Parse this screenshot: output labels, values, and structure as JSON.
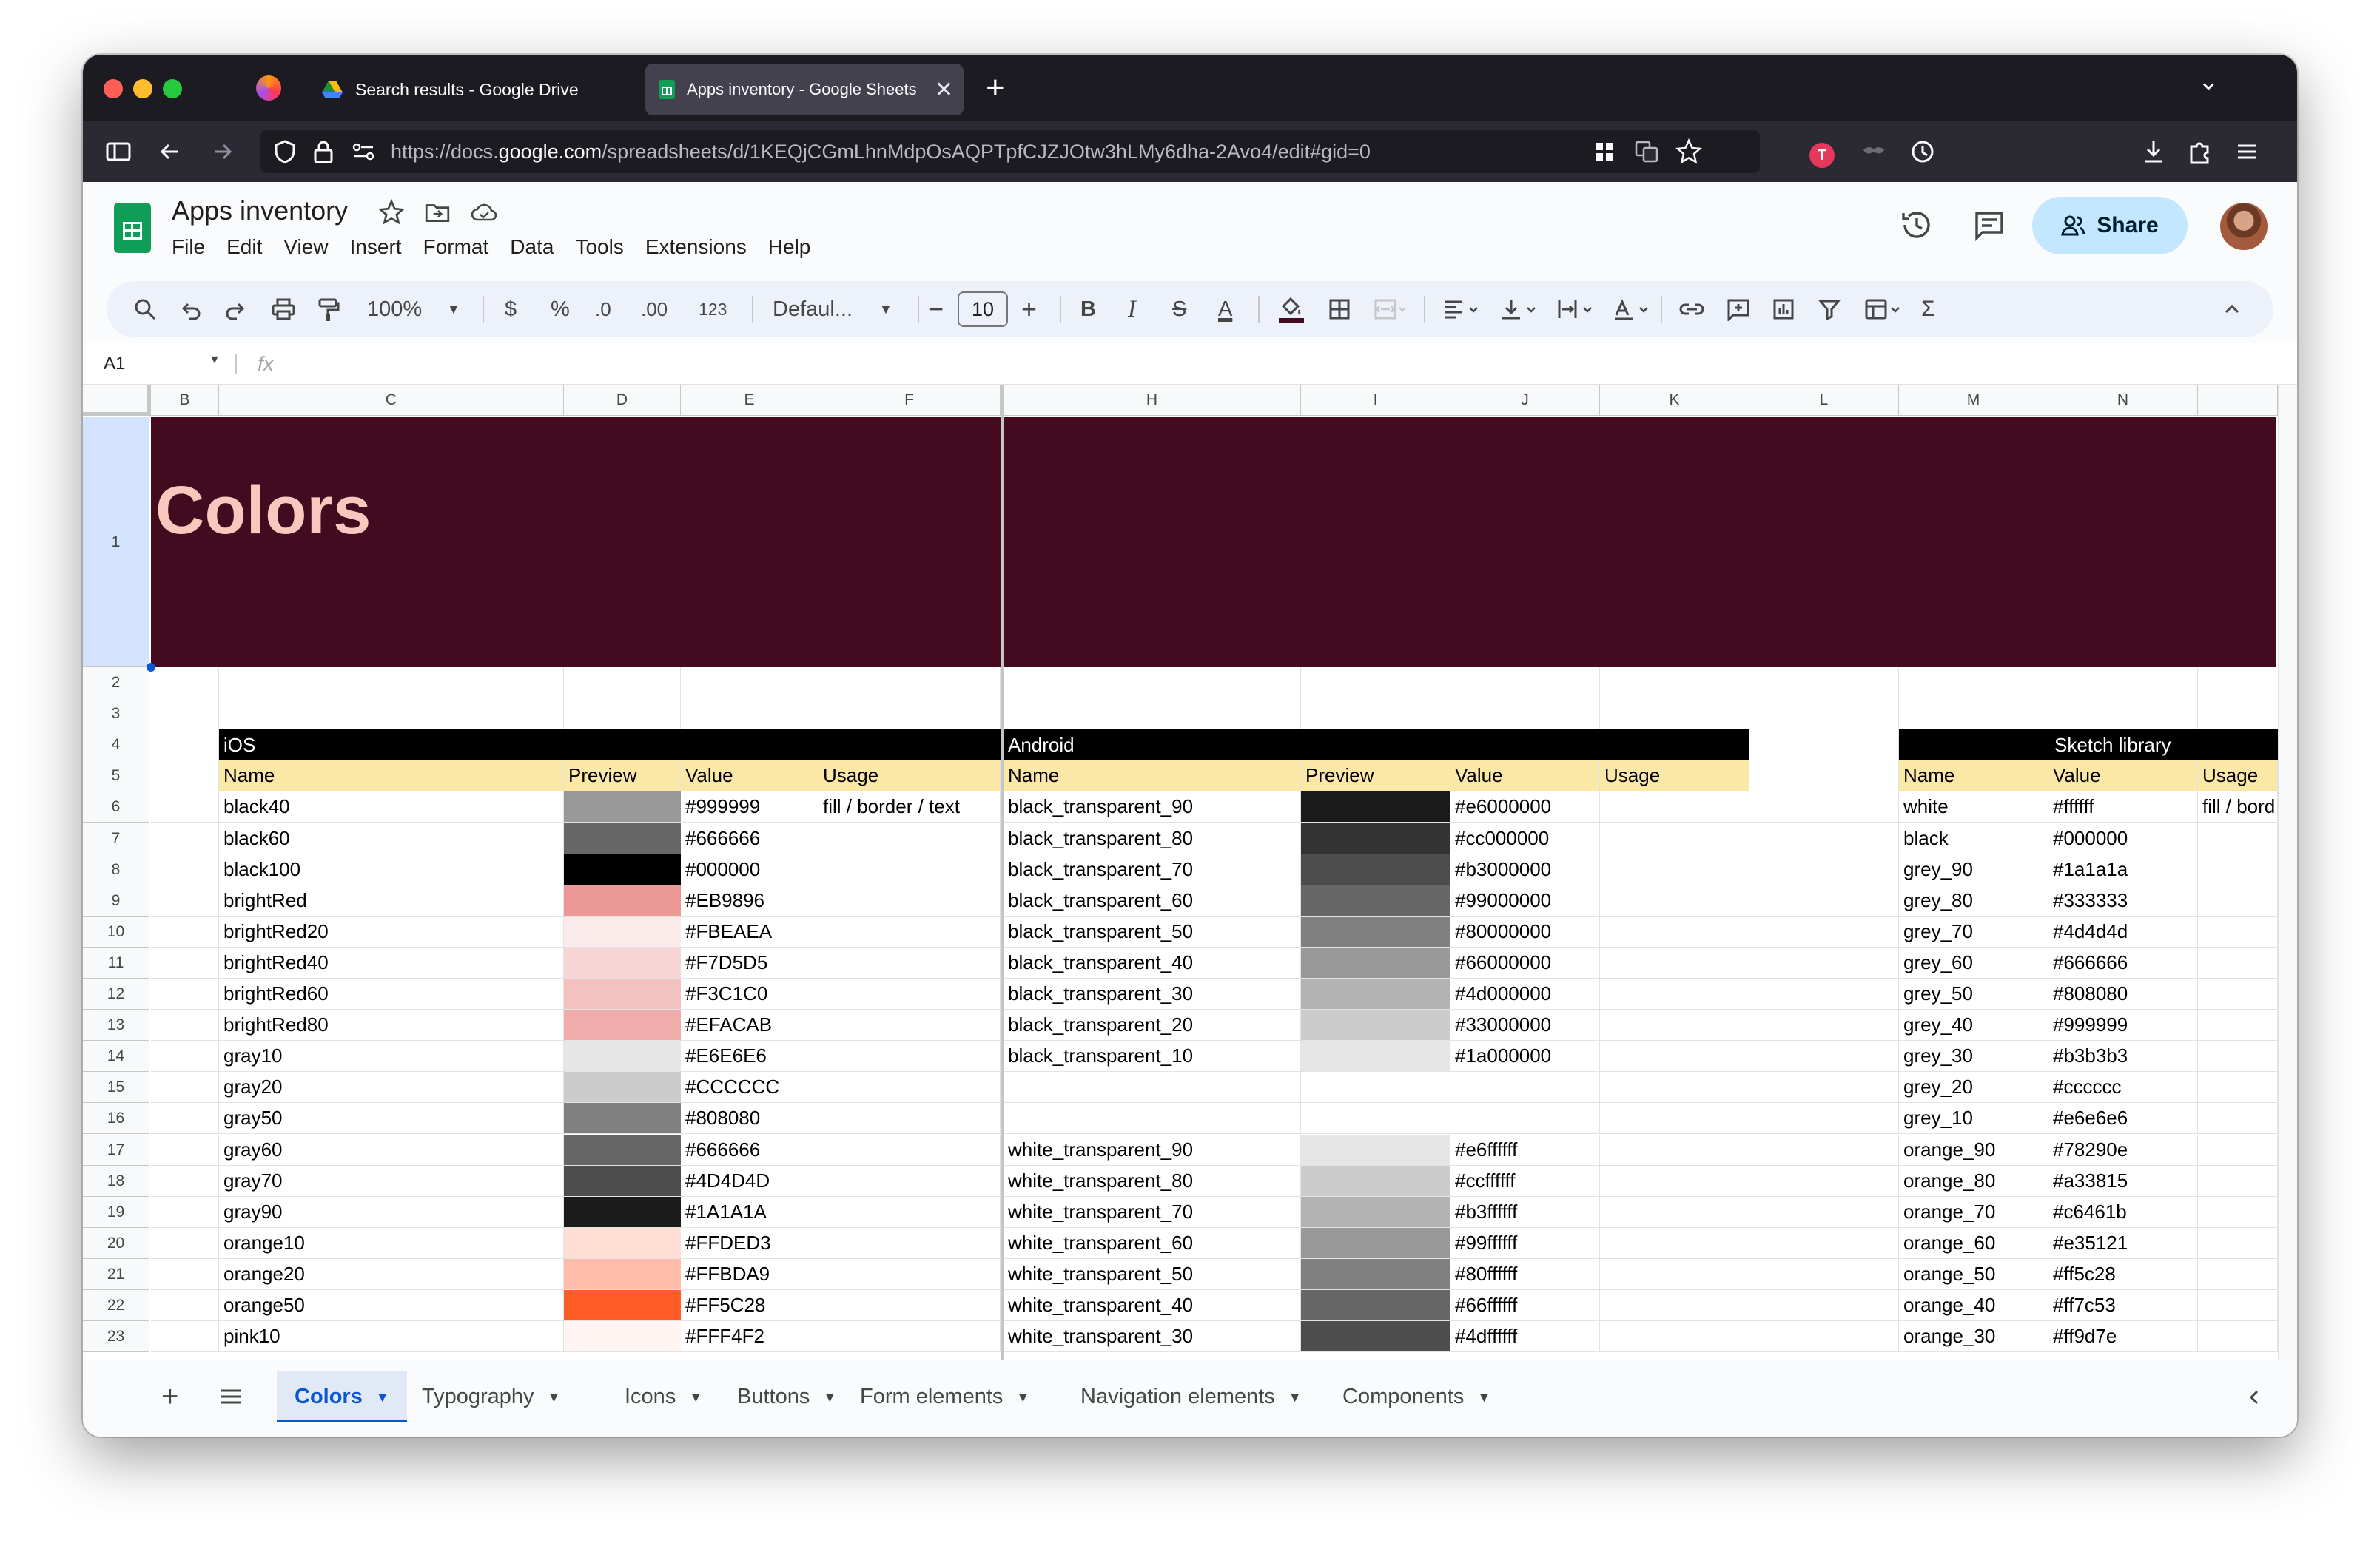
{
  "browser": {
    "tabs": [
      {
        "title": "Search results - Google Drive",
        "close": "✕"
      },
      {
        "title": "Apps inventory - Google Sheets",
        "close": "✕"
      }
    ],
    "new_tab": "+",
    "tab_list": "⌄",
    "url_prefix": "https://docs.",
    "url_domain": "google.com",
    "url_rest": "/spreadsheets/d/1KEQjCGmLhnMdpOsAQPTpfCJZJOtw3hLMy6dha-2Avo4/edit#gid=0",
    "extension_badge": "T"
  },
  "doc": {
    "title": "Apps inventory",
    "menu": [
      "File",
      "Edit",
      "View",
      "Insert",
      "Format",
      "Data",
      "Tools",
      "Extensions",
      "Help"
    ],
    "share_label": "Share"
  },
  "toolbar": {
    "zoom": "100%",
    "currency": "$",
    "percent": "%",
    "dec_decrease": ".0",
    "dec_increase": ".00",
    "number_format": "123",
    "font": "Defaul...",
    "font_size": "10",
    "minus": "−",
    "plus": "+",
    "bold": "B",
    "italic": "I",
    "strike": "S",
    "text_color": "A",
    "sum": "Σ"
  },
  "formula_bar": {
    "cell_ref": "A1",
    "fx": "fx"
  },
  "grid": {
    "columns": [
      "B",
      "C",
      "D",
      "E",
      "F",
      "",
      "H",
      "I",
      "J",
      "K",
      "L",
      "M",
      "N",
      ""
    ],
    "rows": [
      "1",
      "2",
      "3",
      "4",
      "5",
      "6",
      "7",
      "8",
      "9",
      "10",
      "11",
      "12",
      "13",
      "14",
      "15",
      "16",
      "17",
      "18",
      "19",
      "20",
      "21",
      "22",
      "23"
    ],
    "banner_title": "Colors"
  },
  "ios": {
    "title": "iOS",
    "headers": {
      "name": "Name",
      "preview": "Preview",
      "value": "Value",
      "usage": "Usage"
    },
    "rows": [
      {
        "name": "black40",
        "color": "#999999",
        "value": "#999999",
        "usage": "fill / border / text"
      },
      {
        "name": "black60",
        "color": "#666666",
        "value": "#666666",
        "usage": ""
      },
      {
        "name": "black100",
        "color": "#000000",
        "value": "#000000",
        "usage": ""
      },
      {
        "name": "brightRed",
        "color": "#EB9896",
        "value": "#EB9896",
        "usage": ""
      },
      {
        "name": "brightRed20",
        "color": "#FBEAEA",
        "value": "#FBEAEA",
        "usage": ""
      },
      {
        "name": "brightRed40",
        "color": "#F7D5D5",
        "value": "#F7D5D5",
        "usage": ""
      },
      {
        "name": "brightRed60",
        "color": "#F3C1C0",
        "value": "#F3C1C0",
        "usage": ""
      },
      {
        "name": "brightRed80",
        "color": "#EFACAB",
        "value": "#EFACAB",
        "usage": ""
      },
      {
        "name": "gray10",
        "color": "#E6E6E6",
        "value": "#E6E6E6",
        "usage": ""
      },
      {
        "name": "gray20",
        "color": "#CCCCCC",
        "value": "#CCCCCC",
        "usage": ""
      },
      {
        "name": "gray50",
        "color": "#808080",
        "value": "#808080",
        "usage": ""
      },
      {
        "name": "gray60",
        "color": "#666666",
        "value": "#666666",
        "usage": ""
      },
      {
        "name": "gray70",
        "color": "#4D4D4D",
        "value": "#4D4D4D",
        "usage": ""
      },
      {
        "name": "gray90",
        "color": "#1A1A1A",
        "value": "#1A1A1A",
        "usage": ""
      },
      {
        "name": "orange10",
        "color": "#FFDED3",
        "value": "#FFDED3",
        "usage": ""
      },
      {
        "name": "orange20",
        "color": "#FFBDA9",
        "value": "#FFBDA9",
        "usage": ""
      },
      {
        "name": "orange50",
        "color": "#FF5C28",
        "value": "#FF5C28",
        "usage": ""
      },
      {
        "name": "pink10",
        "color": "#FFF4F2",
        "value": "#FFF4F2",
        "usage": ""
      }
    ]
  },
  "android": {
    "title": "Android",
    "headers": {
      "name": "Name",
      "preview": "Preview",
      "value": "Value",
      "usage": "Usage"
    },
    "rows": [
      {
        "name": "black_transparent_90",
        "color": "#1a1a1a",
        "value": "#e6000000"
      },
      {
        "name": "black_transparent_80",
        "color": "#333333",
        "value": "#cc000000"
      },
      {
        "name": "black_transparent_70",
        "color": "#4d4d4d",
        "value": "#b3000000"
      },
      {
        "name": "black_transparent_60",
        "color": "#666666",
        "value": "#99000000"
      },
      {
        "name": "black_transparent_50",
        "color": "#808080",
        "value": "#80000000"
      },
      {
        "name": "black_transparent_40",
        "color": "#999999",
        "value": "#66000000"
      },
      {
        "name": "black_transparent_30",
        "color": "#b3b3b3",
        "value": "#4d000000"
      },
      {
        "name": "black_transparent_20",
        "color": "#cccccc",
        "value": "#33000000"
      },
      {
        "name": "black_transparent_10",
        "color": "#e6e6e6",
        "value": "#1a000000"
      },
      {
        "name": "",
        "color": "",
        "value": ""
      },
      {
        "name": "",
        "color": "",
        "value": ""
      },
      {
        "name": "white_transparent_90",
        "color": "#e6e6e6",
        "value": "#e6ffffff"
      },
      {
        "name": "white_transparent_80",
        "color": "#cccccc",
        "value": "#ccffffff"
      },
      {
        "name": "white_transparent_70",
        "color": "#b3b3b3",
        "value": "#b3ffffff"
      },
      {
        "name": "white_transparent_60",
        "color": "#999999",
        "value": "#99ffffff"
      },
      {
        "name": "white_transparent_50",
        "color": "#808080",
        "value": "#80ffffff"
      },
      {
        "name": "white_transparent_40",
        "color": "#666666",
        "value": "#66ffffff"
      },
      {
        "name": "white_transparent_30",
        "color": "#4d4d4d",
        "value": "#4dffffff"
      }
    ]
  },
  "sketch": {
    "title": "Sketch library",
    "headers": {
      "name": "Name",
      "value": "Value",
      "usage": "Usage"
    },
    "rows": [
      {
        "name": "white",
        "value": "#ffffff",
        "usage": "fill / bord"
      },
      {
        "name": "black",
        "value": "#000000",
        "usage": ""
      },
      {
        "name": "grey_90",
        "value": "#1a1a1a",
        "usage": ""
      },
      {
        "name": "grey_80",
        "value": "#333333",
        "usage": ""
      },
      {
        "name": "grey_70",
        "value": "#4d4d4d",
        "usage": ""
      },
      {
        "name": "grey_60",
        "value": "#666666",
        "usage": ""
      },
      {
        "name": "grey_50",
        "value": "#808080",
        "usage": ""
      },
      {
        "name": "grey_40",
        "value": "#999999",
        "usage": ""
      },
      {
        "name": "grey_30",
        "value": "#b3b3b3",
        "usage": ""
      },
      {
        "name": "grey_20",
        "value": "#cccccc",
        "usage": ""
      },
      {
        "name": "grey_10",
        "value": "#e6e6e6",
        "usage": ""
      },
      {
        "name": "orange_90",
        "value": "#78290e",
        "usage": ""
      },
      {
        "name": "orange_80",
        "value": "#a33815",
        "usage": ""
      },
      {
        "name": "orange_70",
        "value": "#c6461b",
        "usage": ""
      },
      {
        "name": "orange_60",
        "value": "#e35121",
        "usage": ""
      },
      {
        "name": "orange_50",
        "value": "#ff5c28",
        "usage": ""
      },
      {
        "name": "orange_40",
        "value": "#ff7c53",
        "usage": ""
      },
      {
        "name": "orange_30",
        "value": "#ff9d7e",
        "usage": ""
      }
    ]
  },
  "sheet_tabs": [
    "Colors",
    "Typography",
    "Icons",
    "Buttons",
    "Form elements",
    "Navigation elements",
    "Components"
  ],
  "sheet_tab_active": "Colors",
  "colors": {
    "banner": "#430a20",
    "banner_text": "#f9c7bd",
    "header_yellow": "#fce8a6",
    "accent_blue": "#0b57d0"
  }
}
